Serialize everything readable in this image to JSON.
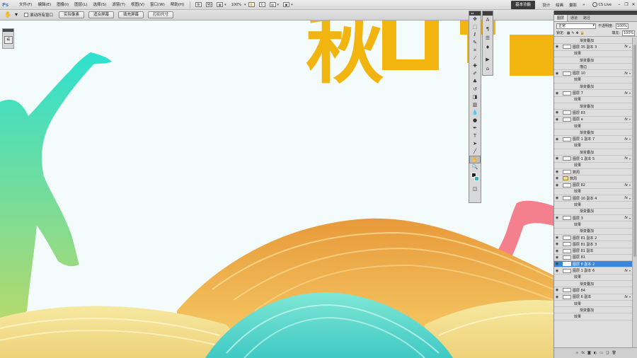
{
  "menubar": {
    "logo": "Ps",
    "items": [
      "文件(F)",
      "编辑(E)",
      "图像(I)",
      "图层(L)",
      "选择(S)",
      "滤镜(T)",
      "视图(V)",
      "窗口(W)",
      "帮助(H)"
    ],
    "zoom": "100%",
    "workspace_active": "基本功能",
    "workspaces": [
      "设计",
      "绘画",
      "摄影"
    ],
    "cslive": "CS Live"
  },
  "optionsbar": {
    "scroll_all_windows": "滚动所有窗口",
    "buttons": [
      "实际像素",
      "适合屏幕",
      "填充屏幕",
      "打印尺寸"
    ]
  },
  "canvas": {
    "headline": "秋",
    "colors": {
      "background": "#f4fbfb",
      "headline": "#f2b40e",
      "figure_left_top": "#2ee0d0",
      "figure_left_bottom": "#b6d96b",
      "figure_right": "#f47f8d",
      "hill_orange": "#f0b24a",
      "hill_yellow": "#f3df8a",
      "hill_teal": "#5cd8c8"
    }
  },
  "layers": {
    "tabs": [
      "图层",
      "通道",
      "路径"
    ],
    "blend_mode": "正常",
    "opacity_label": "不透明度:",
    "opacity": "100%",
    "lock_label": "锁定:",
    "fill_label": "填充:",
    "fill": "100%",
    "rows": [
      {
        "name": "渐变叠加",
        "type": "effect"
      },
      {
        "name": "图层 35 副本 3",
        "type": "layer",
        "fx": true
      },
      {
        "name": "效果",
        "type": "sub"
      },
      {
        "name": "渐变叠加",
        "type": "effect"
      },
      {
        "name": "描边",
        "type": "effect"
      },
      {
        "name": "图层 10",
        "type": "layer",
        "fx": true
      },
      {
        "name": "效果",
        "type": "sub"
      },
      {
        "name": "渐变叠加",
        "type": "effect"
      },
      {
        "name": "图层 7",
        "type": "layer",
        "fx": true
      },
      {
        "name": "效果",
        "type": "sub"
      },
      {
        "name": "渐变叠加",
        "type": "effect"
      },
      {
        "name": "图层 83",
        "type": "layer"
      },
      {
        "name": "图层 a",
        "type": "layer",
        "fx": true
      },
      {
        "name": "效果",
        "type": "sub"
      },
      {
        "name": "渐变叠加",
        "type": "effect"
      },
      {
        "name": "图层 1 副本 7",
        "type": "layer",
        "fx": true
      },
      {
        "name": "效果",
        "type": "sub"
      },
      {
        "name": "渐变叠加",
        "type": "effect"
      },
      {
        "name": "图层 1 副本 5",
        "type": "layer",
        "fx": true
      },
      {
        "name": "效果",
        "type": "sub"
      },
      {
        "name": "数周",
        "type": "layer"
      },
      {
        "name": "数周",
        "type": "group"
      },
      {
        "name": "图层 82",
        "type": "layer",
        "fx": true
      },
      {
        "name": "效果",
        "type": "sub"
      },
      {
        "name": "图层 16 副本 4",
        "type": "layer",
        "fx": true
      },
      {
        "name": "效果",
        "type": "sub"
      },
      {
        "name": "渐变叠加",
        "type": "effect"
      },
      {
        "name": "图层 3",
        "type": "layer",
        "fx": true
      },
      {
        "name": "效果",
        "type": "sub"
      },
      {
        "name": "渐变叠加",
        "type": "effect"
      },
      {
        "name": "图层 81 副本 2",
        "type": "layer"
      },
      {
        "name": "图层 81 副本 3",
        "type": "layer"
      },
      {
        "name": "图层 81 副本",
        "type": "layer"
      },
      {
        "name": "图层 81",
        "type": "layer"
      },
      {
        "name": "图层 8 副本 2",
        "type": "layer",
        "selected": true
      },
      {
        "name": "图层 1 副本 6",
        "type": "layer",
        "fx": true
      },
      {
        "name": "效果",
        "type": "sub"
      },
      {
        "name": "渐变叠加",
        "type": "effect"
      },
      {
        "name": "图层 84",
        "type": "layer"
      },
      {
        "name": "图层 6 副本",
        "type": "layer",
        "fx": true
      },
      {
        "name": "效果",
        "type": "sub"
      },
      {
        "name": "渐变叠加",
        "type": "effect"
      },
      {
        "name": "效果",
        "type": "sub"
      }
    ],
    "bottom_icons": [
      "link-icon",
      "fx-icon",
      "mask-icon",
      "adjustment-icon",
      "folder-icon",
      "new-layer-icon",
      "trash-icon"
    ],
    "bottom_glyphs": [
      "∞",
      "fx",
      "◙",
      "◐",
      "▭",
      "❑",
      "🗑"
    ]
  }
}
